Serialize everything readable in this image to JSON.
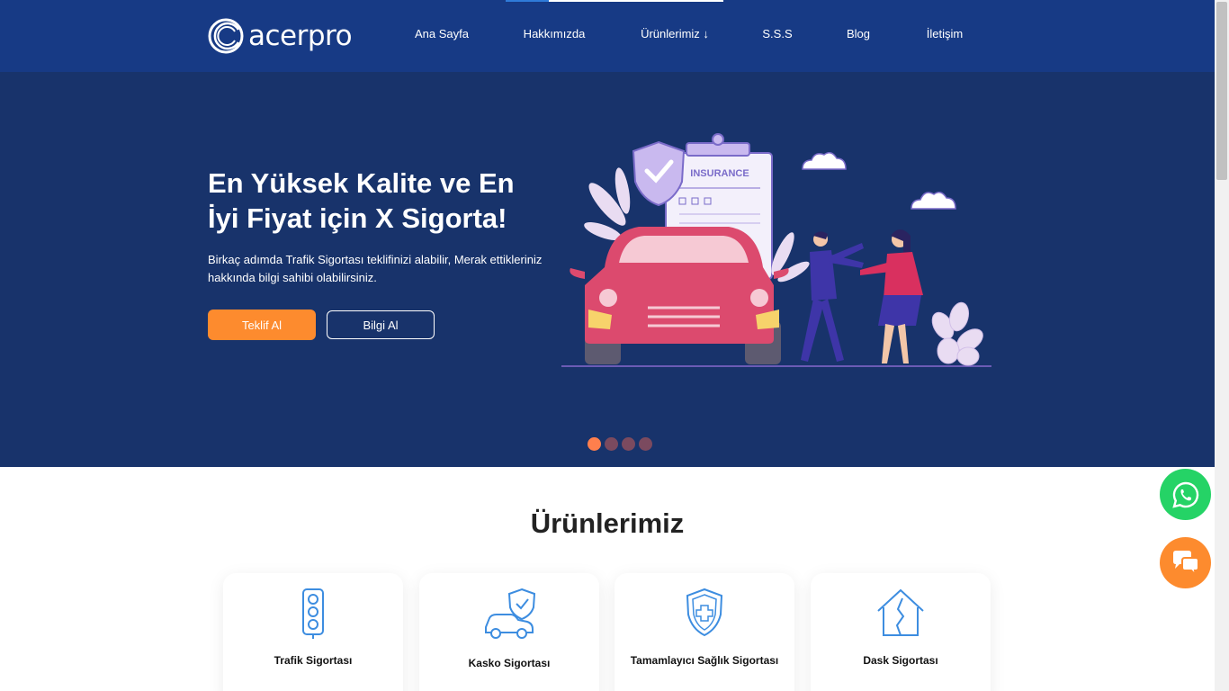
{
  "header": {
    "logo_text": "acerpro",
    "nav": [
      {
        "label": "Ana Sayfa"
      },
      {
        "label": "Hakkımızda"
      },
      {
        "label": "Ürünlerimiz ↓"
      },
      {
        "label": "S.S.S"
      },
      {
        "label": "Blog"
      },
      {
        "label": "İletişim"
      }
    ]
  },
  "hero": {
    "title": "En Yüksek Kalite ve En İyi Fiyat için X Sigorta!",
    "description": "Birkaç adımda Trafik Sigortası teklifinizi alabilir, Merak ettikleriniz hakkında bilgi sahibi olabilirsiniz.",
    "primary_button": "Teklif Al",
    "secondary_button": "Bilgi Al",
    "illustration_text": "INSURANCE",
    "slides_count": 4,
    "active_slide": 1
  },
  "products": {
    "title": "Ürünlerimiz",
    "items": [
      {
        "label": "Trafik Sigortası",
        "icon": "traffic-light-icon"
      },
      {
        "label": "Kasko Sigortası",
        "icon": "car-shield-icon"
      },
      {
        "label": "Tamamlayıcı Sağlık Sigortası",
        "icon": "health-shield-icon"
      },
      {
        "label": "Dask Sigortası",
        "icon": "house-crack-icon"
      }
    ]
  },
  "floating": {
    "whatsapp_icon": "whatsapp-icon",
    "chat_icon": "chat-bubbles-icon"
  },
  "colors": {
    "header_bg": "#173a85",
    "hero_bg": "#18336b",
    "accent_orange": "#fd8b2e",
    "whatsapp_green": "#25d366",
    "icon_blue": "#3d8de0"
  }
}
